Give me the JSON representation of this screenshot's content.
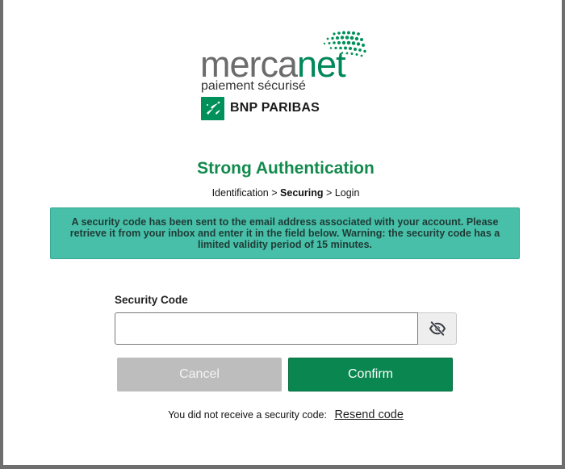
{
  "brand": {
    "name_part1": "merca",
    "name_part2": "net",
    "tagline": "paiement sécurisé",
    "bank_name": "BNP PARIBAS",
    "colors": {
      "gray": "#6b6b6b",
      "green": "#00875a"
    }
  },
  "header": {
    "title": "Strong Authentication",
    "breadcrumb": {
      "step1": "Identification",
      "separator": ">",
      "step2": "Securing",
      "step3": "Login"
    }
  },
  "info": {
    "message": "A security code has been sent to the email address associated with your account. Please retrieve it from your inbox and enter it in the field below. Warning: the security code has a limited validity period of 15 minutes.",
    "color": "#48bfa8"
  },
  "form": {
    "code_label": "Security Code",
    "code_value": "",
    "toggle_icon": "eye-slash-icon",
    "cancel_label": "Cancel",
    "confirm_label": "Confirm",
    "confirm_color": "#0a8750",
    "cancel_color": "#bdbdbd"
  },
  "resend": {
    "prompt": "You did not receive a security code:",
    "link_label": "Resend code"
  }
}
